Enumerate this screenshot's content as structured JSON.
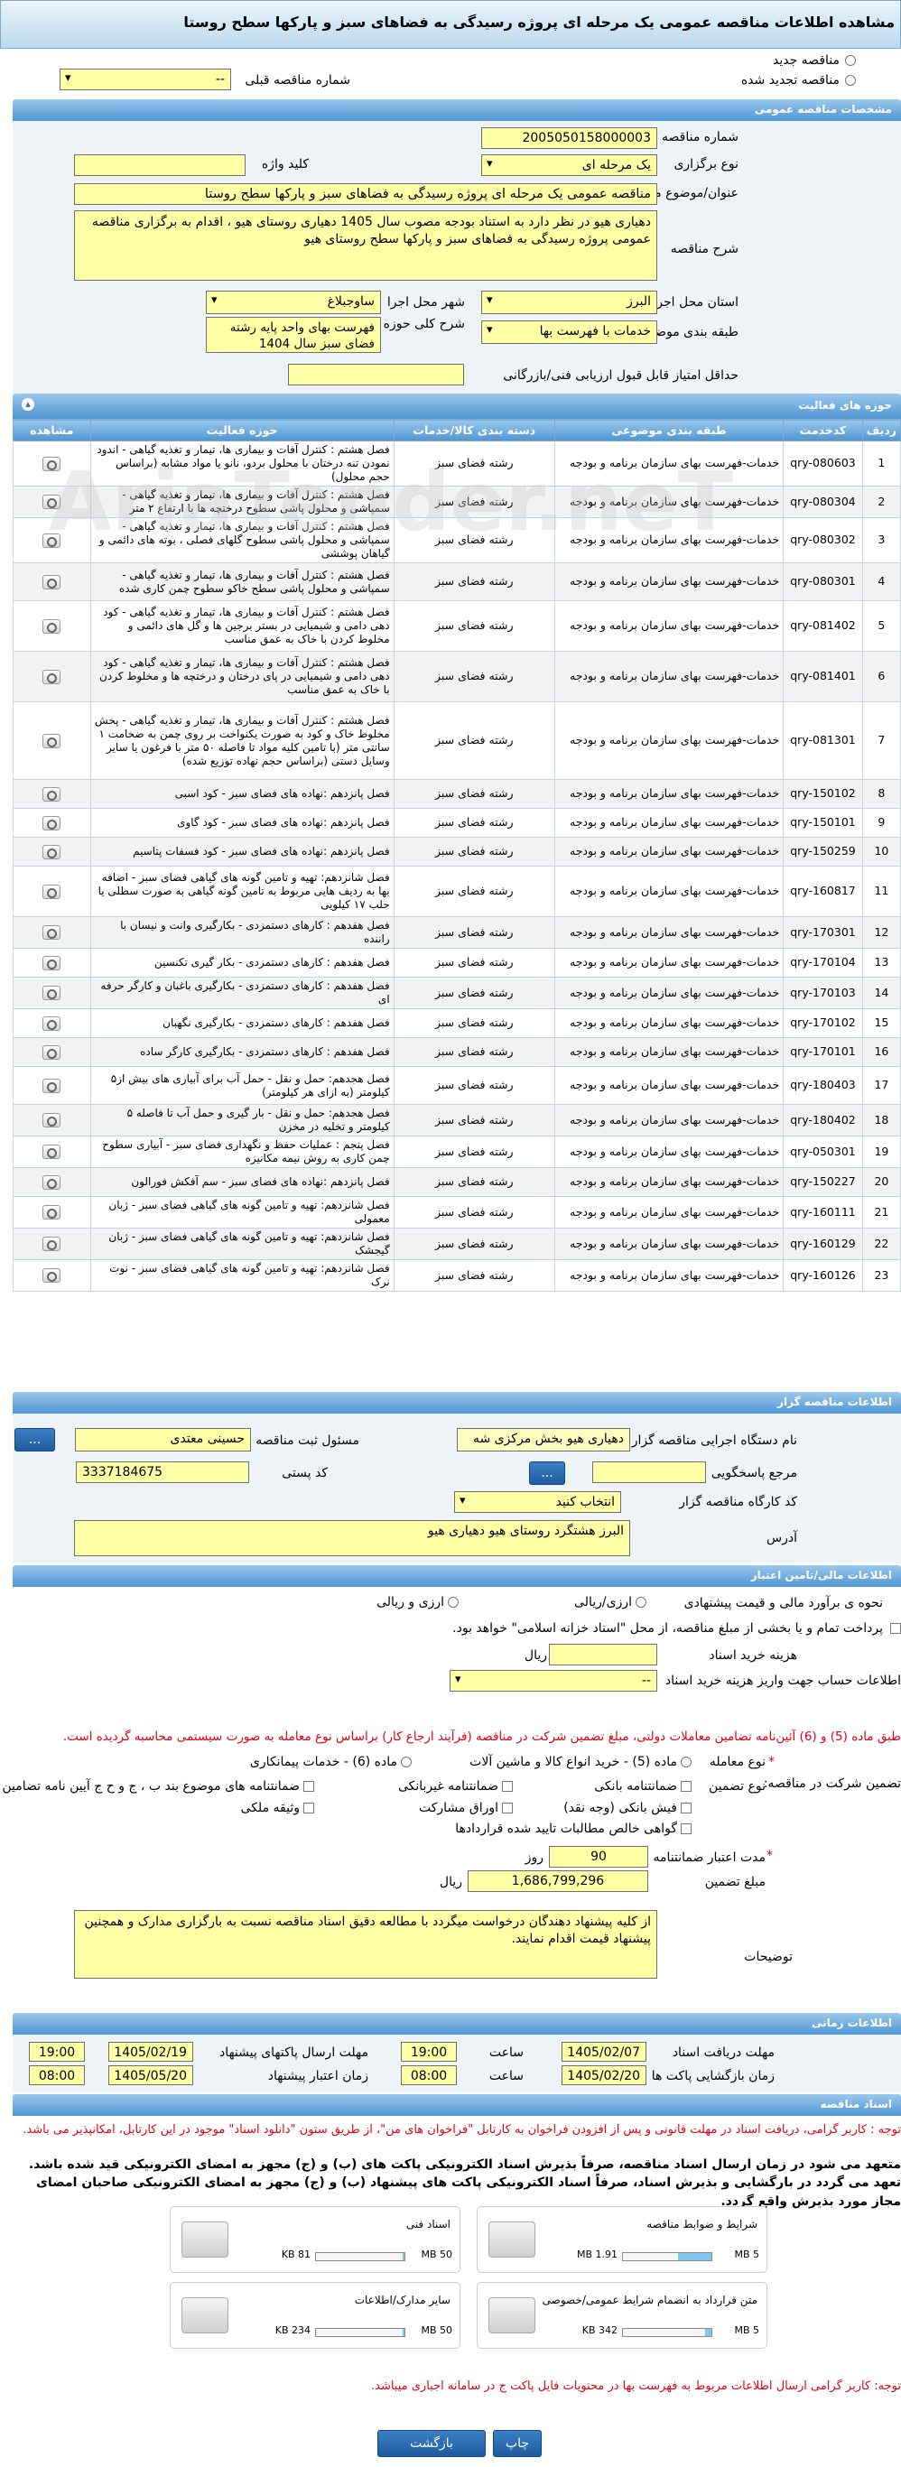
{
  "title": "مشاهده اطلاعات مناقصه عمومی یک مرحله ای پروژه رسیدگی به فضاهای سبز و پارکها سطح روستا",
  "top": {
    "new_tender": "مناقصه جدید",
    "renewed_tender": "مناقصه تجدید شده",
    "prev_number_label": "شماره مناقصه قبلی",
    "prev_number_value": "--"
  },
  "general": {
    "header": "مشخصات مناقصه عمومی",
    "number_label": "شماره مناقصه",
    "number_value": "2005050158000003",
    "type_label": "نوع برگزاری",
    "type_value": "یک مرحله ای",
    "keyword_label": "کلید واژه",
    "keyword_value": "",
    "subject_label": "عنوان/موضوع مناقصه",
    "subject_value": "مناقصه عمومی یک مرحله ای پروژه رسیدگی به فضاهای سبز و پارکها سطح روستا",
    "desc_label": "شرح مناقصه",
    "desc_value": "دهیاری هیو در نظر دارد به استناد بودجه مصوب سال 1405 دهیاری روستای هیو ، اقدام به برگزاری مناقصه عمومی پروژه رسیدگی به فضاهای سبز  و پارکها سطح روستای هیو",
    "province_label": "استان محل اجرا",
    "province_value": "البرز",
    "city_label": "شهر محل اجرا",
    "city_value": "ساوجبلاغ",
    "category_label": "طبقه بندی موضوعی",
    "category_value": "خدمات با فهرست بها",
    "scope_label": "شرح کلی حوزه فعالیت",
    "scope_value": "فهرست بهای واحد پایه رشته فضای سبز سال 1404",
    "min_score_label": "حداقل امتیاز قابل قبول ارزیابی فنی/بازرگانی",
    "min_score_value": ""
  },
  "activities": {
    "header": "حوزه های فعالیت",
    "columns": [
      "ردیف",
      "کدخدمت",
      "طبقه بندی موضوعی",
      "دسته بندی کالا/خدمات",
      "حوزه فعالیت",
      "مشاهده"
    ],
    "rows": [
      {
        "n": "1",
        "code": "qry-080603",
        "cat": "خدمات-فهرست بهای سازمان برنامه و بودجه",
        "group": "رشته فضای سبز",
        "act": "فصل هشتم : کنترل آفات و بیماری ها، تیمار و تغذیه گیاهی - اندود نمودن تنه درختان با محلول بردو، نانو یا مواد مشابه (براساس حجم محلول)"
      },
      {
        "n": "2",
        "code": "qry-080304",
        "cat": "خدمات-فهرست بهای سازمان برنامه و بودجه",
        "group": "رشته فضای سبز",
        "act": "فصل هشتم : کنترل آفات و بیماری ها، تیمار و تغذیه گیاهی - سمپاشی و محلول پاشی سطوح درختچه ها با ارتفاع ۲ متر"
      },
      {
        "n": "3",
        "code": "qry-080302",
        "cat": "خدمات-فهرست بهای سازمان برنامه و بودجه",
        "group": "رشته فضای سبز",
        "act": "فصل هشتم : کنترل آفات و بیماری ها، تیمار و تغذیه گیاهی - سمپاشی و محلول پاشی سطوح گلهای فصلی ، بوته های دائمی و گیاهان پوششی"
      },
      {
        "n": "4",
        "code": "qry-080301",
        "cat": "خدمات-فهرست بهای سازمان برنامه و بودجه",
        "group": "رشته فضای سبز",
        "act": "فصل هشتم : کنترل آفات و بیماری ها، تیمار و تغذیه گیاهی - سمپاشی و محلول پاشی سطح خاکو سطوح چمن کاری شده"
      },
      {
        "n": "5",
        "code": "qry-081402",
        "cat": "خدمات-فهرست بهای سازمان برنامه و بودجه",
        "group": "رشته فضای سبز",
        "act": "فصل هشتم : کنترل آفات و بیماری ها، تیمار و تغذیه گیاهی - کود دهی دامی و شیمیایی در بستر برجین ها و گل های دائمی و مخلوط کردن با خاک به عمق مناسب"
      },
      {
        "n": "6",
        "code": "qry-081401",
        "cat": "خدمات-فهرست بهای سازمان برنامه و بودجه",
        "group": "رشته فضای سبز",
        "act": "فصل هشتم : کنترل آفات و بیماری ها، تیمار و تغذیه گیاهی - کود دهی دامی و شیمیایی در پای درختان و درختچه ها و مخلوط کردن با خاک به عمق مناسب"
      },
      {
        "n": "7",
        "code": "qry-081301",
        "cat": "خدمات-فهرست بهای سازمان برنامه و بودجه",
        "group": "رشته فضای سبز",
        "act": "فصل هشتم : کنترل آفات و بیماری ها، تیمار و تغذیه گیاهی - پخش مخلوط خاک و کود به صورت یکنواخت بر روی چمن به ضخامت ۱ سانتی متر (با تامین کلیه مواد تا فاصله ۵۰ متر با فرغون یا سایر وسایل دستی (براساس حجم نهاده توزیع شده)"
      },
      {
        "n": "8",
        "code": "qry-150102",
        "cat": "خدمات-فهرست بهای سازمان برنامه و بودجه",
        "group": "رشته فضای سبز",
        "act": "فصل پانزدهم :نهاده های فضای سبز - کود اسبی"
      },
      {
        "n": "9",
        "code": "qry-150101",
        "cat": "خدمات-فهرست بهای سازمان برنامه و بودجه",
        "group": "رشته فضای سبز",
        "act": "فصل پانزدهم :نهاده های فضای سبز - کود گاوی"
      },
      {
        "n": "10",
        "code": "qry-150259",
        "cat": "خدمات-فهرست بهای سازمان برنامه و بودجه",
        "group": "رشته فضای سبز",
        "act": "فصل پانزدهم :نهاده های فضای سبز - کود فسفات پتاسیم"
      },
      {
        "n": "11",
        "code": "qry-160817",
        "cat": "خدمات-فهرست بهای سازمان برنامه و بودجه",
        "group": "رشته فضای سبز",
        "act": "فصل شانزدهم: تهیه و تامین گونه های گیاهی فضای سبز - اضافه بها به ردیف هایی مربوط به تامین گونه گیاهی به صورت سطلی یا حلب ۱۷ کیلویی"
      },
      {
        "n": "12",
        "code": "qry-170301",
        "cat": "خدمات-فهرست بهای سازمان برنامه و بودجه",
        "group": "رشته فضای سبز",
        "act": "فصل هفدهم : کارهای دستمزدی - بکارگیری وانت و نیسان با راننده"
      },
      {
        "n": "13",
        "code": "qry-170104",
        "cat": "خدمات-فهرست بهای سازمان برنامه و بودجه",
        "group": "رشته فضای سبز",
        "act": "فصل هفدهم : کارهای دستمزدی - بکار گیری تکنسین"
      },
      {
        "n": "14",
        "code": "qry-170103",
        "cat": "خدمات-فهرست بهای سازمان برنامه و بودجه",
        "group": "رشته فضای سبز",
        "act": "فصل هفدهم : کارهای دستمزدی - بکارگیری باغبان و کارگر حرفه ای"
      },
      {
        "n": "15",
        "code": "qry-170102",
        "cat": "خدمات-فهرست بهای سازمان برنامه و بودجه",
        "group": "رشته فضای سبز",
        "act": "فصل هفدهم : کارهای دستمزدی - بکارگیری نگهبان"
      },
      {
        "n": "16",
        "code": "qry-170101",
        "cat": "خدمات-فهرست بهای سازمان برنامه و بودجه",
        "group": "رشته فضای سبز",
        "act": "فصل هفدهم : کارهای دستمزدی - بکارگیری کارگر ساده"
      },
      {
        "n": "17",
        "code": "qry-180403",
        "cat": "خدمات-فهرست بهای سازمان برنامه و بودجه",
        "group": "رشته فضای سبز",
        "act": "فصل هجدهم: حمل و نقل - حمل آب برای آبیاری های بیش از۵ کیلومتر (به ازای هر کیلومتر)"
      },
      {
        "n": "18",
        "code": "qry-180402",
        "cat": "خدمات-فهرست بهای سازمان برنامه و بودجه",
        "group": "رشته فضای سبز",
        "act": "فصل هجدهم: حمل و نقل - بار گیری و حمل آب تا فاصله ۵ کیلومتر و تخلیه در مخزن"
      },
      {
        "n": "19",
        "code": "qry-050301",
        "cat": "خدمات-فهرست بهای سازمان برنامه و بودجه",
        "group": "رشته فضای سبز",
        "act": "فصل پنجم : عملیات حفظ و نگهداری فضای سبز - آبیاری سطوح چمن کاری به روش نیمه مکانیزه"
      },
      {
        "n": "20",
        "code": "qry-150227",
        "cat": "خدمات-فهرست بهای سازمان برنامه و بودجه",
        "group": "رشته فضای سبز",
        "act": "فصل پانزدهم :نهاده های فضای سبز - سم آفکش فورالون"
      },
      {
        "n": "21",
        "code": "qry-160111",
        "cat": "خدمات-فهرست بهای سازمان برنامه و بودجه",
        "group": "رشته فضای سبز",
        "act": "فصل شانزدهم: تهیه و تامین گونه های گیاهی فضای سبز - ژبان معمولی"
      },
      {
        "n": "22",
        "code": "qry-160129",
        "cat": "خدمات-فهرست بهای سازمان برنامه و بودجه",
        "group": "رشته فضای سبز",
        "act": "فصل شانزدهم: تهیه و تامین گونه های گیاهی فضای سبز - ژبان گیجشک"
      },
      {
        "n": "23",
        "code": "qry-160126",
        "cat": "خدمات-فهرست بهای سازمان برنامه و بودجه",
        "group": "رشته فضای سبز",
        "act": "فصل شانزدهم: تهیه و تامین گونه های گیاهی فضای سبز - نوت نرک"
      }
    ]
  },
  "organizer": {
    "header": "اطلاعات مناقصه گزار",
    "org_label": "نام دستگاه اجرایی مناقصه گزار",
    "org_value": "دهیاری هیو بخش مرکزی شه",
    "resp_label": "مسئول ثبت مناقصه",
    "resp_value": "حسینی معتدی",
    "ref_label": "مرجع پاسخگویی",
    "ref_value": "",
    "postal_label": "کد پستی",
    "postal_value": "3337184675",
    "workshop_label": "کد کارگاه مناقصه گزار",
    "workshop_value": "انتخاب کنید",
    "address_label": "آدرس",
    "address_value": "البرز هشتگرد روستای هیو دهیاری هیو",
    "more_btn": "...",
    "ref_btn": "..."
  },
  "finance": {
    "header": "اطلاعات مالی/تامین اعتبار",
    "estimate_label": "نحوه ی برآورد مالی و قیمت پیشنهادی",
    "opt_rial": "ارزی/ریالی",
    "opt_fx": "ارزی و ریالی",
    "note": "پرداخت تمام و یا بخشی از مبلغ مناقصه، از محل \"اسناد خزانه اسلامی\" خواهد بود.",
    "doc_fee_label": "هزینه خرید اسناد",
    "doc_fee_value": "",
    "doc_fee_unit": "ریال",
    "account_label": "اطلاعات حساب جهت واریز هزینه خرید اسناد",
    "account_value": "--",
    "law_note": "طبق ماده (5) و (6) آئین‌نامه تضامین معاملات دولتی، مبلغ تضمین شرکت در مناقصه (فرآیند ارجاع کار) براساس نوع معامله به صورت سیستمی محاسبه گردیده است.",
    "guarantee_label": "تضمین شرکت در مناقصه:",
    "deal_type_label": "نوع معامله",
    "deal_opts": [
      "ماده (5) - خرید انواع کالا و ماشین آلات",
      "ماده (6) - خدمات پیمانکاری"
    ],
    "guarantee_type_label": "نوع تضمین",
    "guarantee_types": [
      "ضمانتنامه بانکی",
      "ضمانتنامه غیربانکی",
      "ضمانتنامه های موضوع بند ب ، ج و ح ج آیین نامه تضامین",
      "فیش بانکی (وجه نقد)",
      "اوراق مشارکت",
      "وثیقه ملکی",
      "گواهی خالص مطالبات تایید شده قراردادها"
    ],
    "validity_label": "مدت اعتبار ضمانتنامه بانکی",
    "validity_value": "90",
    "validity_unit": "روز",
    "amount_label": "مبلغ تضمین",
    "amount_value": "1,686,799,296",
    "amount_unit": "ریال",
    "notes_label": "توضیحات",
    "notes_value": "از کلیه پیشنهاد دهندگان درخواست میگردد با مطالعه دقیق اسناد مناقصه نسبت به بارگزاری مدارک و همچنین پیشنهاد قیمت اقدام نمایند."
  },
  "timing": {
    "header": "اطلاعات زمانی",
    "receive_label": "مهلت دریافت اسناد",
    "receive_date": "1405/02/07",
    "receive_time": "19:00",
    "send_label": "مهلت ارسال پاکتهای پیشنهاد",
    "send_date": "1405/02/19",
    "send_time": "19:00",
    "open_label": "زمان بازگشایی پاکت ها",
    "open_date": "1405/02/20",
    "open_time": "08:00",
    "valid_label": "زمان اعتبار پیشنهاد",
    "valid_date": "1405/05/20",
    "valid_time": "08:00",
    "time_label": "ساعت"
  },
  "docs": {
    "header": "اسناد مناقصه",
    "note1": "توجه : کاربر گرامی، دریافت اسناد در مهلت قانونی و پس از افزودن فراخوان به کارتابل \"فراخوان های من\"، از طریق ستون \"دانلود اسناد\" موجود در این کارتابل، امکانپذیر می باشد.",
    "note2": "متعهد می شود در زمان ارسال اسناد مناقصه، صرفاً بذیرش اسناد الکترونیکی پاکت های (ب) و (ج) مجهز به امضای الکترونیکی قید شده باشد. تعهد می گردد در بارگشایی و بذیرش اسناد، صرفاً اسناد الکترونیکی پاکت های پیشنهاد (ب) و (ج) مجهز به امضای الکترونیکی صاحبان امضای مجاز مورد بذیرش واقع گردد.",
    "boxes": [
      {
        "name": "شرایط و ضوابط مناقصه",
        "used": "1.91 MB",
        "max": "5 MB",
        "pct": 0.38
      },
      {
        "name": "اسناد فنی",
        "used": "81 KB",
        "max": "50 MB",
        "pct": 0.02
      },
      {
        "name": "متن قرارداد به انضمام شرایط عمومی/خصوصی",
        "used": "342 KB",
        "max": "5 MB",
        "pct": 0.07
      },
      {
        "name": "سایر مدارک/اطلاعات",
        "used": "234 KB",
        "max": "50 MB",
        "pct": 0.02
      }
    ],
    "note3": "توجه: کاربر گرامی ارسال اطلاعات مربوط به فهرست بها در محتویات فایل پاکت ج در سامانه اجباری میباشد."
  },
  "footer": {
    "back": "بازگشت",
    "print": "چاپ"
  },
  "watermark": "AriaTender.neT"
}
